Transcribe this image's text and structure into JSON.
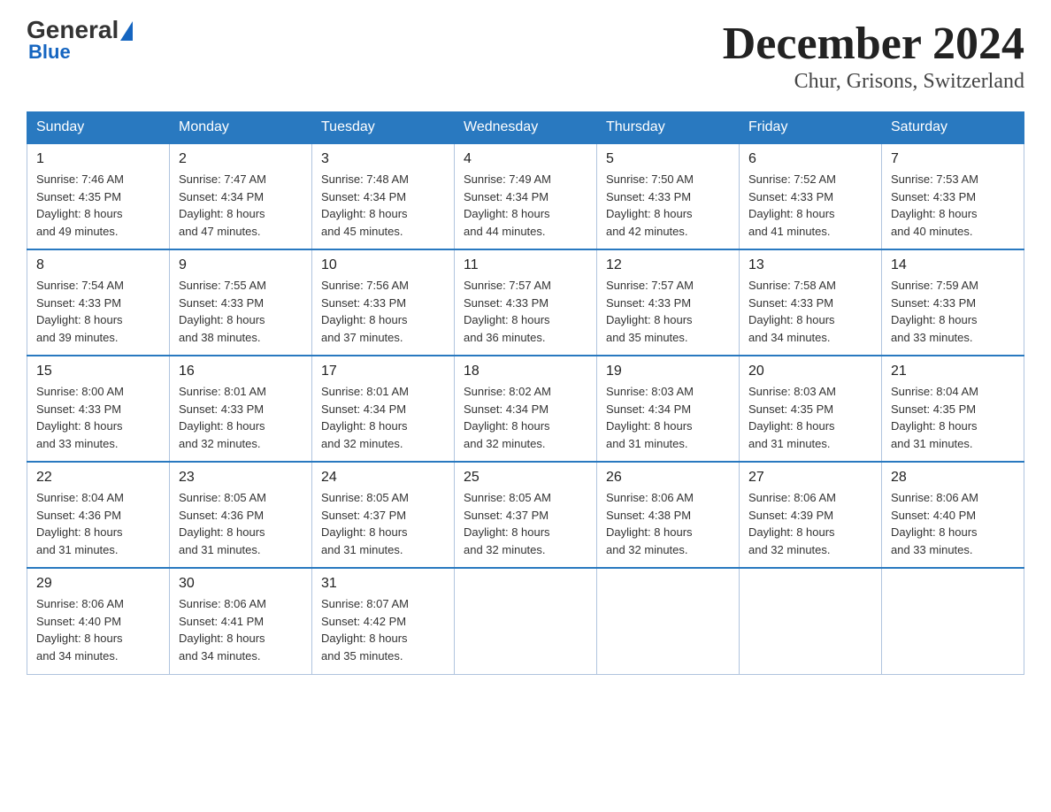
{
  "header": {
    "logo_general": "General",
    "logo_blue": "Blue",
    "title": "December 2024",
    "subtitle": "Chur, Grisons, Switzerland"
  },
  "weekdays": [
    "Sunday",
    "Monday",
    "Tuesday",
    "Wednesday",
    "Thursday",
    "Friday",
    "Saturday"
  ],
  "weeks": [
    [
      {
        "day": "1",
        "sunrise": "7:46 AM",
        "sunset": "4:35 PM",
        "daylight": "8 hours and 49 minutes."
      },
      {
        "day": "2",
        "sunrise": "7:47 AM",
        "sunset": "4:34 PM",
        "daylight": "8 hours and 47 minutes."
      },
      {
        "day": "3",
        "sunrise": "7:48 AM",
        "sunset": "4:34 PM",
        "daylight": "8 hours and 45 minutes."
      },
      {
        "day": "4",
        "sunrise": "7:49 AM",
        "sunset": "4:34 PM",
        "daylight": "8 hours and 44 minutes."
      },
      {
        "day": "5",
        "sunrise": "7:50 AM",
        "sunset": "4:33 PM",
        "daylight": "8 hours and 42 minutes."
      },
      {
        "day": "6",
        "sunrise": "7:52 AM",
        "sunset": "4:33 PM",
        "daylight": "8 hours and 41 minutes."
      },
      {
        "day": "7",
        "sunrise": "7:53 AM",
        "sunset": "4:33 PM",
        "daylight": "8 hours and 40 minutes."
      }
    ],
    [
      {
        "day": "8",
        "sunrise": "7:54 AM",
        "sunset": "4:33 PM",
        "daylight": "8 hours and 39 minutes."
      },
      {
        "day": "9",
        "sunrise": "7:55 AM",
        "sunset": "4:33 PM",
        "daylight": "8 hours and 38 minutes."
      },
      {
        "day": "10",
        "sunrise": "7:56 AM",
        "sunset": "4:33 PM",
        "daylight": "8 hours and 37 minutes."
      },
      {
        "day": "11",
        "sunrise": "7:57 AM",
        "sunset": "4:33 PM",
        "daylight": "8 hours and 36 minutes."
      },
      {
        "day": "12",
        "sunrise": "7:57 AM",
        "sunset": "4:33 PM",
        "daylight": "8 hours and 35 minutes."
      },
      {
        "day": "13",
        "sunrise": "7:58 AM",
        "sunset": "4:33 PM",
        "daylight": "8 hours and 34 minutes."
      },
      {
        "day": "14",
        "sunrise": "7:59 AM",
        "sunset": "4:33 PM",
        "daylight": "8 hours and 33 minutes."
      }
    ],
    [
      {
        "day": "15",
        "sunrise": "8:00 AM",
        "sunset": "4:33 PM",
        "daylight": "8 hours and 33 minutes."
      },
      {
        "day": "16",
        "sunrise": "8:01 AM",
        "sunset": "4:33 PM",
        "daylight": "8 hours and 32 minutes."
      },
      {
        "day": "17",
        "sunrise": "8:01 AM",
        "sunset": "4:34 PM",
        "daylight": "8 hours and 32 minutes."
      },
      {
        "day": "18",
        "sunrise": "8:02 AM",
        "sunset": "4:34 PM",
        "daylight": "8 hours and 32 minutes."
      },
      {
        "day": "19",
        "sunrise": "8:03 AM",
        "sunset": "4:34 PM",
        "daylight": "8 hours and 31 minutes."
      },
      {
        "day": "20",
        "sunrise": "8:03 AM",
        "sunset": "4:35 PM",
        "daylight": "8 hours and 31 minutes."
      },
      {
        "day": "21",
        "sunrise": "8:04 AM",
        "sunset": "4:35 PM",
        "daylight": "8 hours and 31 minutes."
      }
    ],
    [
      {
        "day": "22",
        "sunrise": "8:04 AM",
        "sunset": "4:36 PM",
        "daylight": "8 hours and 31 minutes."
      },
      {
        "day": "23",
        "sunrise": "8:05 AM",
        "sunset": "4:36 PM",
        "daylight": "8 hours and 31 minutes."
      },
      {
        "day": "24",
        "sunrise": "8:05 AM",
        "sunset": "4:37 PM",
        "daylight": "8 hours and 31 minutes."
      },
      {
        "day": "25",
        "sunrise": "8:05 AM",
        "sunset": "4:37 PM",
        "daylight": "8 hours and 32 minutes."
      },
      {
        "day": "26",
        "sunrise": "8:06 AM",
        "sunset": "4:38 PM",
        "daylight": "8 hours and 32 minutes."
      },
      {
        "day": "27",
        "sunrise": "8:06 AM",
        "sunset": "4:39 PM",
        "daylight": "8 hours and 32 minutes."
      },
      {
        "day": "28",
        "sunrise": "8:06 AM",
        "sunset": "4:40 PM",
        "daylight": "8 hours and 33 minutes."
      }
    ],
    [
      {
        "day": "29",
        "sunrise": "8:06 AM",
        "sunset": "4:40 PM",
        "daylight": "8 hours and 34 minutes."
      },
      {
        "day": "30",
        "sunrise": "8:06 AM",
        "sunset": "4:41 PM",
        "daylight": "8 hours and 34 minutes."
      },
      {
        "day": "31",
        "sunrise": "8:07 AM",
        "sunset": "4:42 PM",
        "daylight": "8 hours and 35 minutes."
      },
      null,
      null,
      null,
      null
    ]
  ],
  "labels": {
    "sunrise": "Sunrise: ",
    "sunset": "Sunset: ",
    "daylight": "Daylight: "
  }
}
